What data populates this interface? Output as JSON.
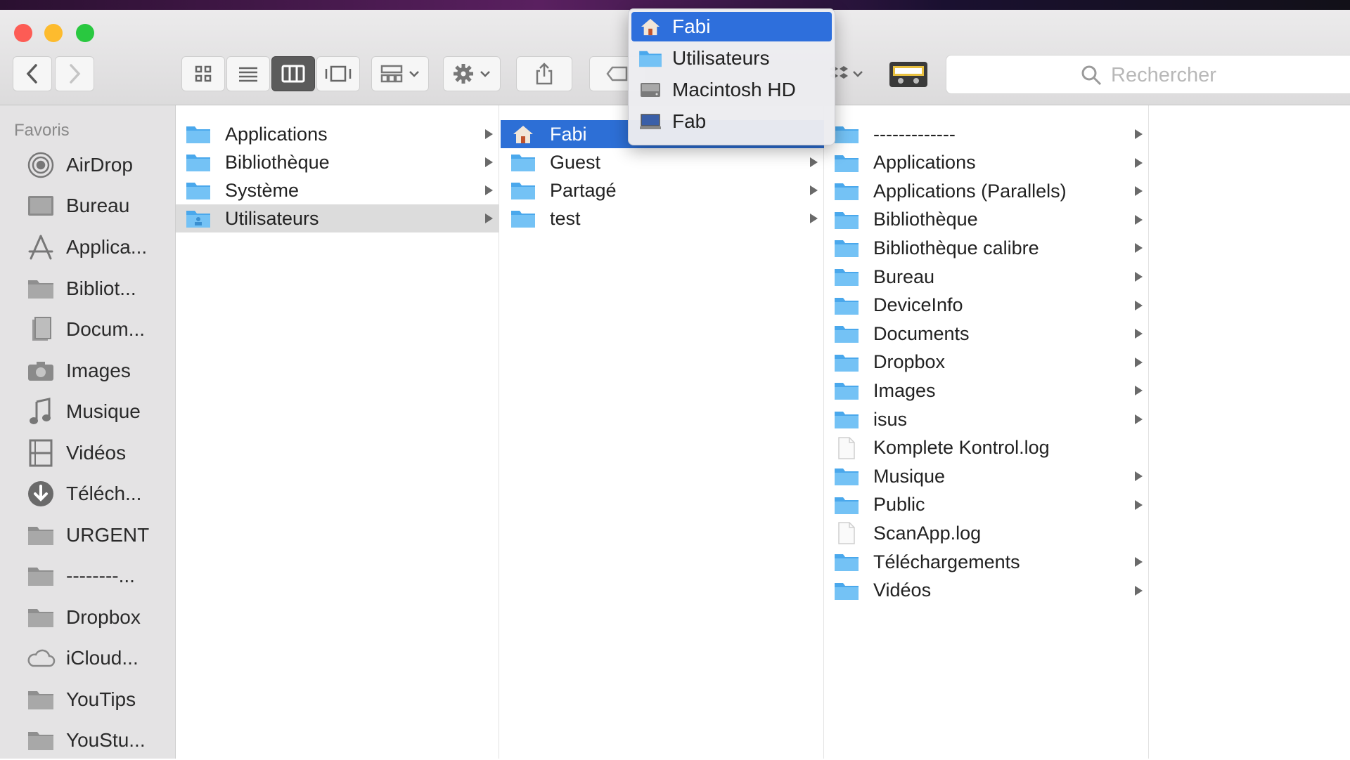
{
  "toolbar": {
    "search_placeholder": "Rechercher"
  },
  "sidebar": {
    "heading": "Favoris",
    "items": [
      {
        "label": "AirDrop",
        "icon": "airdrop-icon"
      },
      {
        "label": "Bureau",
        "icon": "desktop-icon"
      },
      {
        "label": "Applica...",
        "icon": "applications-icon"
      },
      {
        "label": "Bibliot...",
        "icon": "folder-icon"
      },
      {
        "label": "Docum...",
        "icon": "documents-icon"
      },
      {
        "label": "Images",
        "icon": "camera-icon"
      },
      {
        "label": "Musique",
        "icon": "music-note-icon"
      },
      {
        "label": "Vidéos",
        "icon": "film-icon"
      },
      {
        "label": "Téléch...",
        "icon": "download-icon"
      },
      {
        "label": "URGENT",
        "icon": "folder-icon"
      },
      {
        "label": "--------...",
        "icon": "folder-icon"
      },
      {
        "label": "Dropbox",
        "icon": "folder-icon"
      },
      {
        "label": "iCloud...",
        "icon": "cloud-icon"
      },
      {
        "label": "YouTips",
        "icon": "folder-icon"
      },
      {
        "label": "YouStu...",
        "icon": "folder-icon"
      }
    ]
  },
  "column1": {
    "items": [
      {
        "label": "Applications"
      },
      {
        "label": "Bibliothèque"
      },
      {
        "label": "Système"
      },
      {
        "label": "Utilisateurs"
      }
    ]
  },
  "column2": {
    "items": [
      {
        "label": "Fabi"
      },
      {
        "label": "Guest"
      },
      {
        "label": "Partagé"
      },
      {
        "label": "test"
      }
    ]
  },
  "column3": {
    "items": [
      {
        "label": "-------------"
      },
      {
        "label": "Applications"
      },
      {
        "label": "Applications (Parallels)"
      },
      {
        "label": "Bibliothèque"
      },
      {
        "label": "Bibliothèque calibre"
      },
      {
        "label": "Bureau"
      },
      {
        "label": "DeviceInfo"
      },
      {
        "label": "Documents"
      },
      {
        "label": "Dropbox"
      },
      {
        "label": "Images"
      },
      {
        "label": "isus"
      },
      {
        "label": "Komplete Kontrol.log"
      },
      {
        "label": "Musique"
      },
      {
        "label": "Public"
      },
      {
        "label": "ScanApp.log"
      },
      {
        "label": "Téléchargements"
      },
      {
        "label": "Vidéos"
      }
    ]
  },
  "path_menu": {
    "items": [
      {
        "label": "Fabi",
        "icon": "home-icon"
      },
      {
        "label": "Utilisateurs",
        "icon": "folder-icon"
      },
      {
        "label": "Macintosh HD",
        "icon": "hard-drive-icon"
      },
      {
        "label": "Fab",
        "icon": "computer-icon"
      }
    ]
  },
  "colors": {
    "selection_blue": "#2d6fd6",
    "folder_blue": "#5fb6ef"
  }
}
